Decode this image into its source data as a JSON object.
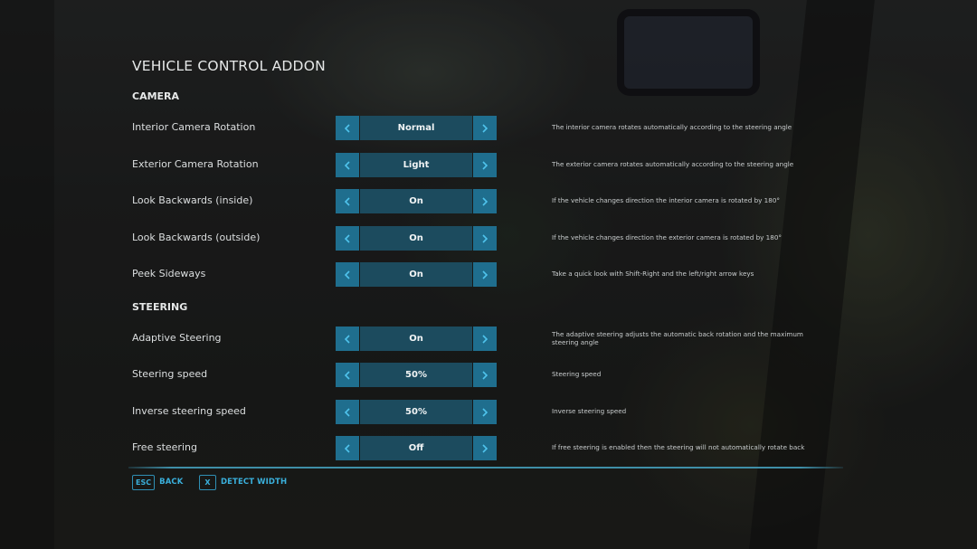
{
  "page": {
    "title": "VEHICLE CONTROL ADDON"
  },
  "colors": {
    "accent": "#3ab0dc",
    "arrow_bg": "#1f6e8e",
    "value_bg": "#1c4b5e",
    "text": "#e6e8e8"
  },
  "sections": [
    {
      "title": "CAMERA",
      "settings": [
        {
          "label": "Interior Camera Rotation",
          "value": "Normal",
          "description": "The interior camera rotates automatically according to the steering angle"
        },
        {
          "label": "Exterior Camera Rotation",
          "value": "Light",
          "description": "The exterior camera rotates automatically according to the steering angle"
        },
        {
          "label": "Look Backwards (inside)",
          "value": "On",
          "description": "If the vehicle changes direction the interior camera is rotated by 180°"
        },
        {
          "label": "Look Backwards (outside)",
          "value": "On",
          "description": "If the vehicle changes direction the exterior camera is rotated by 180°"
        },
        {
          "label": "Peek Sideways",
          "value": "On",
          "description": "Take a quick look with Shift-Right and the left/right arrow keys"
        }
      ]
    },
    {
      "title": "STEERING",
      "settings": [
        {
          "label": "Adaptive Steering",
          "value": "On",
          "description": "The adaptive steering adjusts the automatic back rotation and the maximum steering angle"
        },
        {
          "label": "Steering speed",
          "value": "50%",
          "description": "Steering speed"
        },
        {
          "label": "Inverse steering speed",
          "value": "50%",
          "description": "Inverse steering speed"
        },
        {
          "label": "Free steering",
          "value": "Off",
          "description": "If free steering is enabled then the steering will not automatically rotate back"
        }
      ]
    }
  ],
  "icons": {
    "prev": "chevron-left-icon",
    "next": "chevron-right-icon"
  },
  "footer": {
    "back": {
      "key": "ESC",
      "label": "BACK"
    },
    "detect_width": {
      "key": "X",
      "label": "DETECT WIDTH"
    }
  }
}
